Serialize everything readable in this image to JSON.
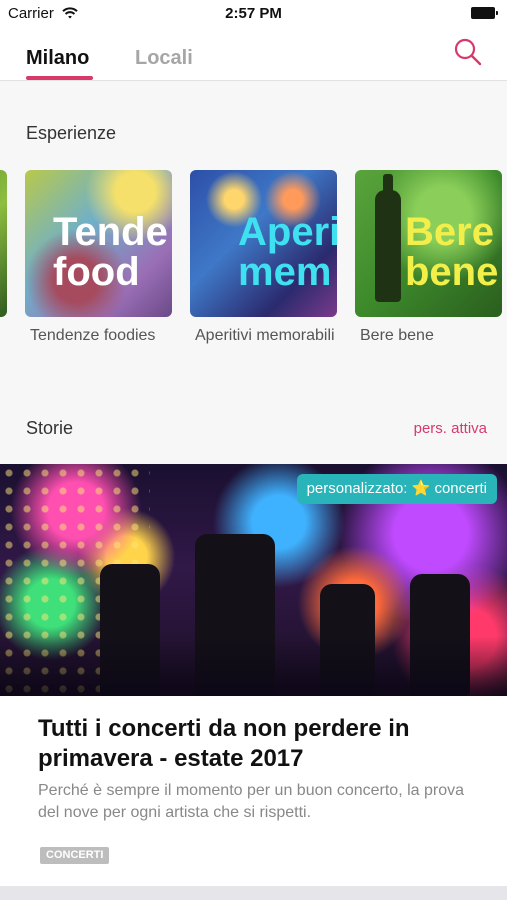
{
  "status_bar": {
    "carrier": "Carrier",
    "time": "2:57 PM"
  },
  "nav": {
    "tabs": [
      {
        "label": "Milano",
        "active": true
      },
      {
        "label": "Locali",
        "active": false
      }
    ],
    "search_icon": "search-icon",
    "accent_color": "#d63a6b"
  },
  "experiences": {
    "title": "Esperienze",
    "cards": [
      {
        "overlay": "Tende\nfood",
        "label": "Tendenze foodies"
      },
      {
        "overlay": "Aperi\nmem",
        "label": "Aperitivi memorabili"
      },
      {
        "overlay": "Bere\nbene",
        "label": "Bere bene"
      }
    ]
  },
  "stories": {
    "title": "Storie",
    "pers_link": "pers. attiva",
    "featured": {
      "badge": "personalizzato: ⭐ concerti",
      "badge_color": "#28b4b8",
      "title": "Tutti i concerti da non perdere in primavera - estate 2017",
      "description": "Perché è sempre il momento per un buon concerto, la prova del nove per ogni artista che si rispetti.",
      "tag": "CONCERTI"
    }
  }
}
